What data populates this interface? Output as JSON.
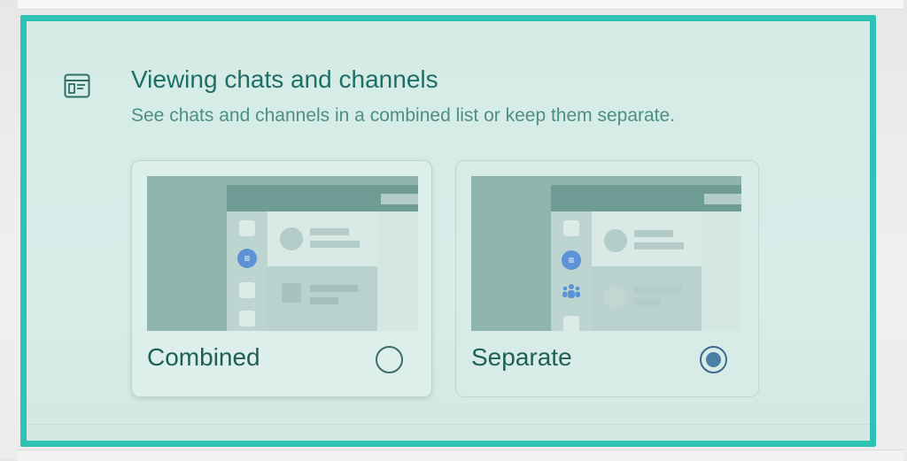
{
  "section": {
    "icon": "layout-panel-icon",
    "title": "Viewing chats and channels",
    "subtitle": "See chats and channels in a combined list or keep them separate."
  },
  "options": [
    {
      "id": "combined",
      "label": "Combined",
      "selected": false
    },
    {
      "id": "separate",
      "label": "Separate",
      "selected": true
    }
  ],
  "colors": {
    "highlight_border": "#2ec2b4",
    "title": "#1e6f66",
    "subtitle": "#4d8e86",
    "radio_selected": "#4a7fa8",
    "chat_icon": "#5b93d6"
  }
}
